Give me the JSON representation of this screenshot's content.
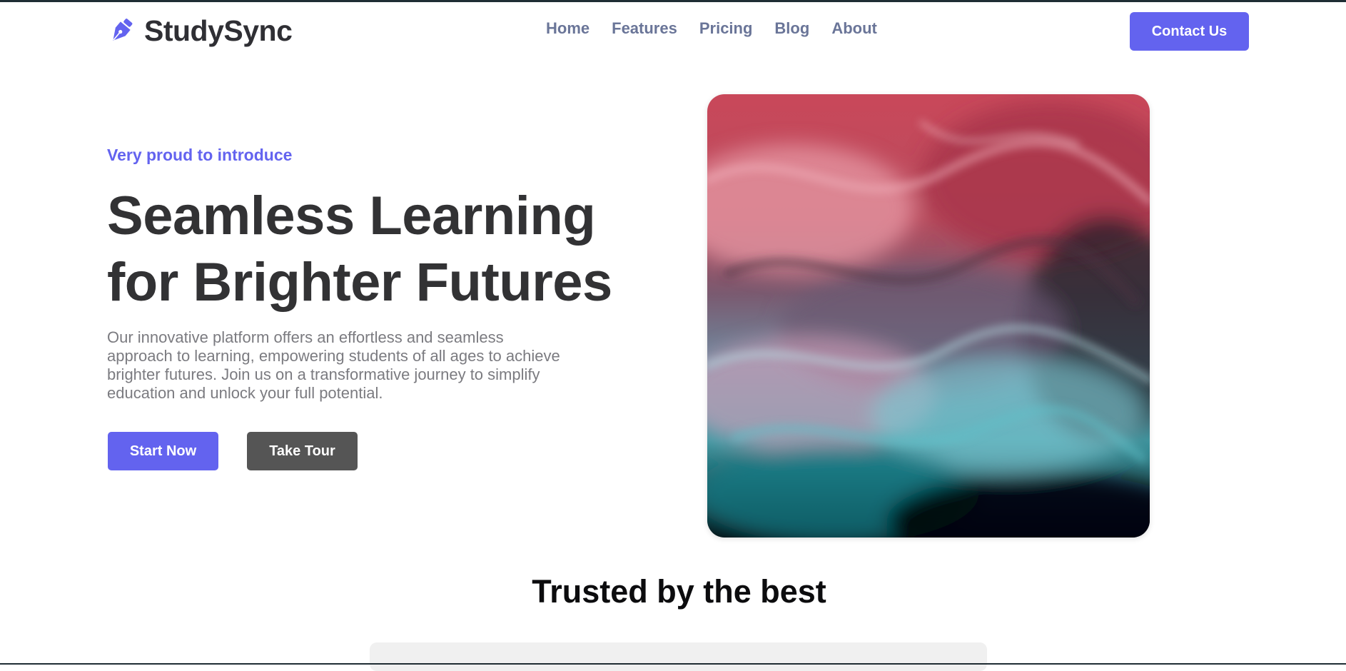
{
  "brand": {
    "name": "StudySync",
    "icon": "pen-nib-icon"
  },
  "nav": {
    "links": [
      "Home",
      "Features",
      "Pricing",
      "Blog",
      "About"
    ],
    "cta_label": "Contact Us"
  },
  "hero": {
    "kicker": "Very proud to introduce",
    "headline_line1": "Seamless Learning",
    "headline_line2": "for Brighter Futures",
    "description": "Our innovative platform offers an effortless and seamless approach to learning, empowering students of all ages to achieve brighter futures. Join us on a transformative journey to simplify education and unlock your full potential.",
    "primary_button": "Start Now",
    "secondary_button": "Take Tour"
  },
  "trusted": {
    "title": "Trusted by the best"
  },
  "colors": {
    "accent": "#6363ef",
    "heading": "#323234",
    "nav_text": "#6a7598",
    "secondary_button": "#555555"
  }
}
